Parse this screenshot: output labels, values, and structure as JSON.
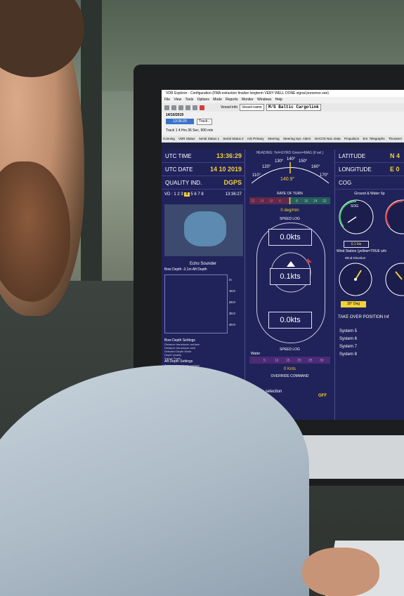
{
  "window": {
    "title": "VDR Explorer - Configuration (FMA extraction finalize longterm VERY WELL DONE signal presence.vee)"
  },
  "menu": [
    "File",
    "View",
    "Tools",
    "Options",
    "Mode",
    "Reports",
    "Monitor",
    "Windows",
    "Help"
  ],
  "toolbar": {
    "vessel_info_label": "Vessel info",
    "vessel_name_combo": "Vessel name",
    "ship_name": "M/S Baltic Cargolink"
  },
  "time_panel": {
    "date": "14/10/2019",
    "time": "13:36:29",
    "track_button": "Track...",
    "track_info": "Track 1     4 Hrs 36 Sec, 900 min"
  },
  "tabs": [
    "Conning",
    "VDR Status",
    "Serial Status 1",
    "Serial Status 2",
    "AIS Primary",
    "Steering",
    "Steering Sys. Alarm",
    "NACOS Nav. Data",
    "Propulsion",
    "Em. Telegraphs",
    "Thrusters"
  ],
  "left": {
    "utc_time_label": "UTC TIME",
    "utc_time_value": "13:36:29",
    "utc_date_label": "UTC DATE",
    "utc_date_value": "14 10 2019",
    "quality_label": "QUALITY IND.",
    "quality_value": "DGPS",
    "vd_label": "VD :",
    "vd_numbers": "1 2 3",
    "vd_highlight": "4",
    "vd_rest": "5 6 7 8",
    "vd_time": "13:36:27",
    "echo_title": "Echo Sounder",
    "echo_sub": "Bow Depth   -3.1m Aft Depth",
    "echo_unit": "m",
    "echo_scale": [
      "10.0",
      "20.0",
      "30.0",
      "40.0"
    ],
    "depth_settings_title": "Bow Depth Settings",
    "depth_lines": [
      "Distance transducer-surface",
      "Distance transducer-keel",
      "Selected Depth Mode",
      "Depth Quality",
      "Range Scale"
    ],
    "aft_settings_title": "Aft Depth Settings",
    "aft_lines": [
      "Distance transducer-surface",
      "Distance transducer-keel",
      "Selected Depth Mode",
      "Depth Quality",
      "Range Scale"
    ]
  },
  "center": {
    "heading_label": "HEADING: Yel=GYRO Green=MAG (if sel.)",
    "heading_ticks": [
      "110°",
      "120°",
      "130°",
      "140°",
      "150°",
      "160°",
      "170°"
    ],
    "heading_value": "140.9°",
    "rot_title": "RATE OF TURN",
    "rot_scale": [
      "32",
      "24",
      "16",
      "8",
      "8",
      "16",
      "24",
      "32"
    ],
    "rot_value": "0 deg/min",
    "speedlog_title": "SPEED LOG",
    "speed_top": "0.0kts",
    "speed_mid": "0.1kts",
    "speed_bottom": "0.0kts",
    "speedlog2_title": "SPEED LOG",
    "water_label": "Water",
    "water_scale": [
      "5",
      "10",
      "15",
      "20",
      "25",
      "30"
    ],
    "water_kts": "0 Knts",
    "override_cmd": "OVERRIDE COMMAND",
    "override_sel": "Override selection",
    "override_val": "OFF"
  },
  "right": {
    "latitude_label": "LATITUDE",
    "latitude_value": "N 4",
    "longitude_label": "LONGITUDE",
    "longitude_value": "E 0",
    "cog_label": "COG",
    "ground_water_title": "Ground & Water Sp",
    "sog_label": "SOG",
    "sog_box": "0.1 kts",
    "wind_title": "Wind Station (yellow=TRUE whi",
    "wind_dir_label": "Wind Direction",
    "wind_deg_box": "30° Deg",
    "takeover": "TAKE OVER POSITION Inf",
    "systems": [
      "System 5",
      "System 6",
      "System 7",
      "System 8"
    ]
  },
  "colors": {
    "dash_bg": "#20225a",
    "accent": "#f2d13a",
    "rot_red": "#d33a3a",
    "rot_green": "#3ec56a"
  },
  "chart_data": {
    "type": "line",
    "heading_deg": 140.9,
    "rot_deg_per_min": 0,
    "sog_kts": 0.1,
    "wind_dir_deg": 30
  }
}
